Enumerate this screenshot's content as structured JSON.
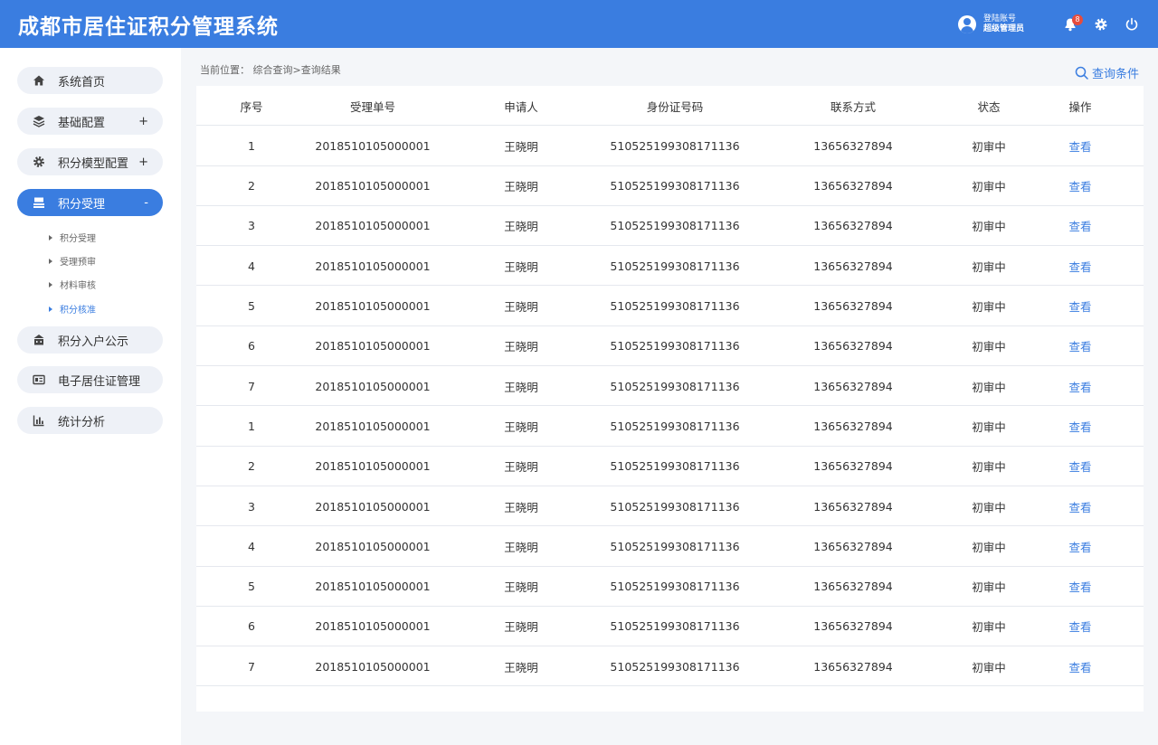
{
  "header": {
    "title": "成都市居住证积分管理系统",
    "user_line1": "登陆账号",
    "user_line2": "超级管理员",
    "notification_count": "8",
    "bg_color": "#3a7de0"
  },
  "sidebar": {
    "items": [
      {
        "label": "系统首页",
        "toggle": "",
        "icon": "home-icon"
      },
      {
        "label": "基础配置",
        "toggle": "+",
        "icon": "layers-icon"
      },
      {
        "label": "积分模型配置",
        "toggle": "+",
        "icon": "gear-icon"
      },
      {
        "label": "积分受理",
        "toggle": "-",
        "icon": "inbox-icon"
      },
      {
        "label": "积分入户公示",
        "toggle": "",
        "icon": "building-icon"
      },
      {
        "label": "电子居住证管理",
        "toggle": "",
        "icon": "id-card-icon"
      },
      {
        "label": "统计分析",
        "toggle": "",
        "icon": "bar-chart-icon"
      }
    ],
    "sub_items": [
      "积分受理",
      "受理预审",
      "材料审核",
      "积分核准"
    ]
  },
  "breadcrumb": "当前位置： 综合查询>查询结果",
  "query_button": "查询条件",
  "table": {
    "headers": [
      "序号",
      "受理单号",
      "申请人",
      "身份证号码",
      "联系方式",
      "状态",
      "操作"
    ],
    "rows": [
      [
        "1",
        "2018510105000001",
        "王晓明",
        "510525199308171136",
        "13656327894",
        "初审中",
        "查看"
      ],
      [
        "2",
        "2018510105000001",
        "王晓明",
        "510525199308171136",
        "13656327894",
        "初审中",
        "查看"
      ],
      [
        "3",
        "2018510105000001",
        "王晓明",
        "510525199308171136",
        "13656327894",
        "初审中",
        "查看"
      ],
      [
        "4",
        "2018510105000001",
        "王晓明",
        "510525199308171136",
        "13656327894",
        "初审中",
        "查看"
      ],
      [
        "5",
        "2018510105000001",
        "王晓明",
        "510525199308171136",
        "13656327894",
        "初审中",
        "查看"
      ],
      [
        "6",
        "2018510105000001",
        "王晓明",
        "510525199308171136",
        "13656327894",
        "初审中",
        "查看"
      ],
      [
        "7",
        "2018510105000001",
        "王晓明",
        "510525199308171136",
        "13656327894",
        "初审中",
        "查看"
      ],
      [
        "1",
        "2018510105000001",
        "王晓明",
        "510525199308171136",
        "13656327894",
        "初审中",
        "查看"
      ],
      [
        "2",
        "2018510105000001",
        "王晓明",
        "510525199308171136",
        "13656327894",
        "初审中",
        "查看"
      ],
      [
        "3",
        "2018510105000001",
        "王晓明",
        "510525199308171136",
        "13656327894",
        "初审中",
        "查看"
      ],
      [
        "4",
        "2018510105000001",
        "王晓明",
        "510525199308171136",
        "13656327894",
        "初审中",
        "查看"
      ],
      [
        "5",
        "2018510105000001",
        "王晓明",
        "510525199308171136",
        "13656327894",
        "初审中",
        "查看"
      ],
      [
        "6",
        "2018510105000001",
        "王晓明",
        "510525199308171136",
        "13656327894",
        "初审中",
        "查看"
      ],
      [
        "7",
        "2018510105000001",
        "王晓明",
        "510525199308171136",
        "13656327894",
        "初审中",
        "查看"
      ]
    ]
  }
}
